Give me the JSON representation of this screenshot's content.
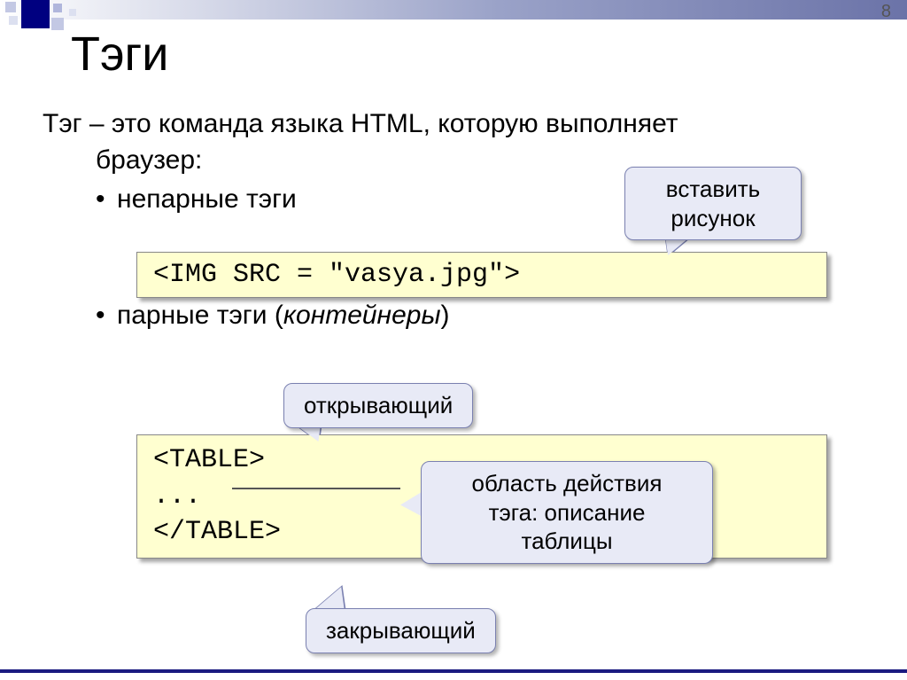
{
  "page_number": "8",
  "title": "Тэги",
  "definition_line1": "Тэг – это команда языка HTML, которую выполняет",
  "definition_line2": "браузер:",
  "bullet1": "непарные тэги",
  "bullet2_prefix": "парные тэги (",
  "bullet2_italic": "контейнеры",
  "bullet2_suffix": ")",
  "code1": "<IMG SRC = \"vasya.jpg\">",
  "code2_line1": "<TABLE>",
  "code2_line2": "...",
  "code2_line3": "</TABLE>",
  "callout_insert_line1": "вставить",
  "callout_insert_line2": "рисунок",
  "callout_opening": "открывающий",
  "callout_scope_line1": "область действия",
  "callout_scope_line2": "тэга: описание",
  "callout_scope_line3": "таблицы",
  "callout_closing": "закрывающий"
}
